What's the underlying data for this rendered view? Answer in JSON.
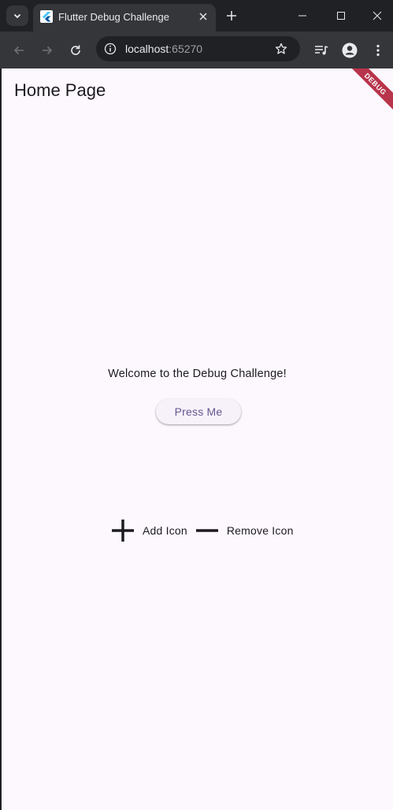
{
  "browser": {
    "tab": {
      "title": "Flutter Debug Challenge",
      "favicon": "flutter-logo-icon"
    },
    "address": {
      "host": "localhost",
      "port": ":65270"
    },
    "colors": {
      "frame": "#202124",
      "toolbar": "#35363a",
      "omnibox": "#202124"
    }
  },
  "page": {
    "appbar_title": "Home Page",
    "debug_banner": "DEBUG",
    "welcome_text": "Welcome to the Debug Challenge!",
    "press_button": "Press Me",
    "icons": [
      {
        "icon": "add-icon",
        "label": "Add Icon"
      },
      {
        "icon": "remove-icon",
        "label": "Remove Icon"
      }
    ],
    "colors": {
      "background": "#fdf7fe",
      "text": "#1d1b20",
      "button_text": "#65558f",
      "banner": "#b7344b"
    }
  }
}
